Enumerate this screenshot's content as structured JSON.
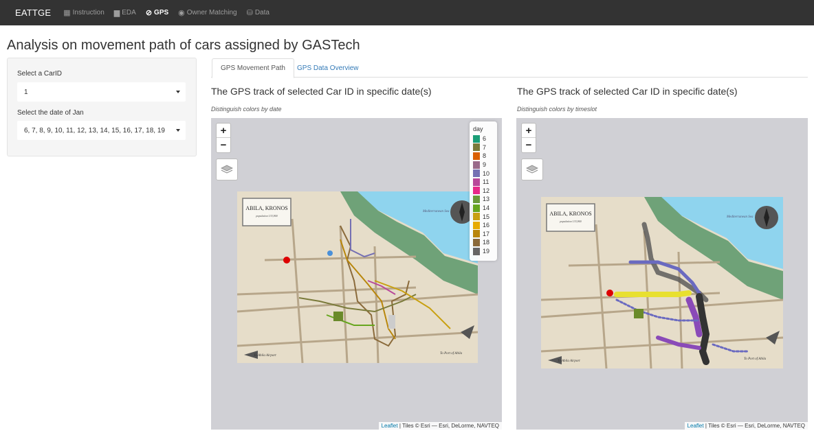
{
  "navbar": {
    "brand": "EATTGE",
    "items": [
      {
        "label": "Instruction",
        "icon": "map-icon",
        "active": false
      },
      {
        "label": "EDA",
        "icon": "bar-chart-icon",
        "active": false
      },
      {
        "label": "GPS",
        "icon": "compass-icon",
        "active": true
      },
      {
        "label": "Owner Matching",
        "icon": "eye-icon",
        "active": false
      },
      {
        "label": "Data",
        "icon": "database-icon",
        "active": false
      }
    ]
  },
  "page": {
    "title": "Analysis on movement path of cars assigned by GASTech"
  },
  "sidebar": {
    "car_label": "Select a CarID",
    "car_value": "1",
    "date_label": "Select the date of Jan",
    "date_value": "6, 7, 8, 9, 10, 11, 12, 13, 14, 15, 16, 17, 18, 19"
  },
  "tabs": [
    {
      "label": "GPS Movement Path",
      "active": true
    },
    {
      "label": "GPS Data Overview",
      "active": false
    }
  ],
  "left_panel": {
    "title": "The GPS track of selected Car ID in specific date(s)",
    "subtitle": "Distinguish colors by date"
  },
  "right_panel": {
    "title": "The GPS track of selected Car ID in specific date(s)",
    "subtitle": "Distinguish colors by timeslot"
  },
  "map": {
    "zoom_in": "+",
    "zoom_out": "−",
    "attribution_link": "Leaflet",
    "attribution_text": " | Tiles © Esri — Esri, DeLorme, NAVTEQ",
    "tile_title": "ABILA, KRONOS",
    "tile_subtitle": "population 133,900",
    "sea_label": "Mediterranean Sea",
    "airport_label": "To Abila Airport",
    "port_label": "To Port of Abila"
  },
  "legend": {
    "title": "day",
    "entries": [
      {
        "label": "6",
        "color": "#1b9e77"
      },
      {
        "label": "7",
        "color": "#7a7a3a"
      },
      {
        "label": "8",
        "color": "#d95f02"
      },
      {
        "label": "9",
        "color": "#9a6a8a"
      },
      {
        "label": "10",
        "color": "#7570b3"
      },
      {
        "label": "11",
        "color": "#b8489a"
      },
      {
        "label": "12",
        "color": "#e7298a"
      },
      {
        "label": "13",
        "color": "#6a9a3a"
      },
      {
        "label": "14",
        "color": "#66a61e"
      },
      {
        "label": "15",
        "color": "#c8a010"
      },
      {
        "label": "16",
        "color": "#e6ab02"
      },
      {
        "label": "17",
        "color": "#b8860b"
      },
      {
        "label": "18",
        "color": "#8a6a3a"
      },
      {
        "label": "19",
        "color": "#666666"
      }
    ]
  }
}
